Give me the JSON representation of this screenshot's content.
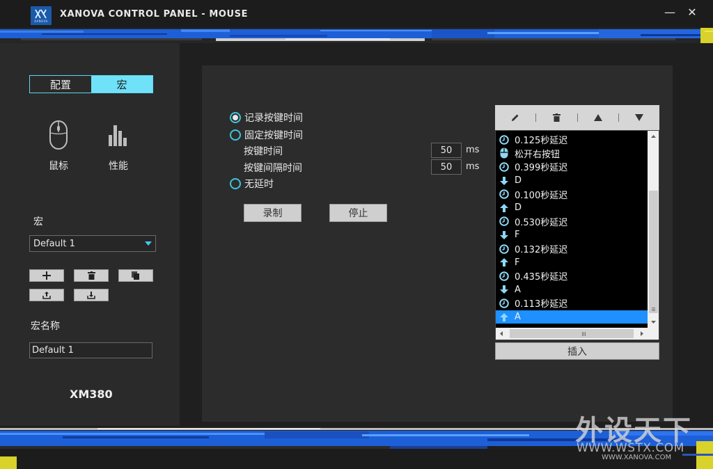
{
  "window": {
    "title": "XANOVA CONTROL PANEL - MOUSE",
    "logo_text": "XANOVA",
    "minimize_symbol": "—",
    "close_symbol": "✕"
  },
  "sidebar": {
    "tabs": [
      {
        "label": "配置",
        "active": false
      },
      {
        "label": "宏",
        "active": true
      }
    ],
    "nav": [
      {
        "label": "鼠标",
        "icon": "mouse-icon"
      },
      {
        "label": "性能",
        "icon": "performance-bars-icon"
      }
    ],
    "macro_label": "宏",
    "macro_select": "Default 1",
    "macro_name_label": "宏名称",
    "macro_name_value": "Default 1",
    "model": "XM380"
  },
  "settings": {
    "options": [
      {
        "label": "记录按键时间",
        "selected": true
      },
      {
        "label": "固定按键时间",
        "selected": false
      },
      {
        "label": "无延时",
        "selected": false
      }
    ],
    "key_time_label": "按键时间",
    "key_time_value": "50",
    "key_interval_label": "按键间隔时间",
    "key_interval_value": "50",
    "unit": "ms",
    "record_button": "录制",
    "stop_button": "停止"
  },
  "macro_list": {
    "rows": [
      {
        "text": "0.125秒延迟",
        "icon": "clock-icon"
      },
      {
        "text": "松开右按钮",
        "icon": "mouse-right-icon"
      },
      {
        "text": "0.399秒延迟",
        "icon": "clock-icon"
      },
      {
        "text": "D",
        "icon": "arrow-down-icon"
      },
      {
        "text": "0.100秒延迟",
        "icon": "clock-icon"
      },
      {
        "text": "D",
        "icon": "arrow-up-icon"
      },
      {
        "text": "0.530秒延迟",
        "icon": "clock-icon"
      },
      {
        "text": "F",
        "icon": "arrow-down-icon"
      },
      {
        "text": "0.132秒延迟",
        "icon": "clock-icon"
      },
      {
        "text": "F",
        "icon": "arrow-up-icon"
      },
      {
        "text": "0.435秒延迟",
        "icon": "clock-icon"
      },
      {
        "text": "A",
        "icon": "arrow-down-icon"
      },
      {
        "text": "0.113秒延迟",
        "icon": "clock-icon"
      },
      {
        "text": "A",
        "icon": "arrow-up-icon",
        "selected": true
      }
    ],
    "insert_button": "插入"
  },
  "watermark": {
    "title": "外设天下",
    "url": "WWW.WSTX.COM",
    "sub": "WWW.XANOVA.COM"
  },
  "colors": {
    "accent": "#6fe1f9",
    "list_icon": "#8ed8f5",
    "selection": "#1e90ff",
    "stripe_blue": "#1d5fd6"
  }
}
